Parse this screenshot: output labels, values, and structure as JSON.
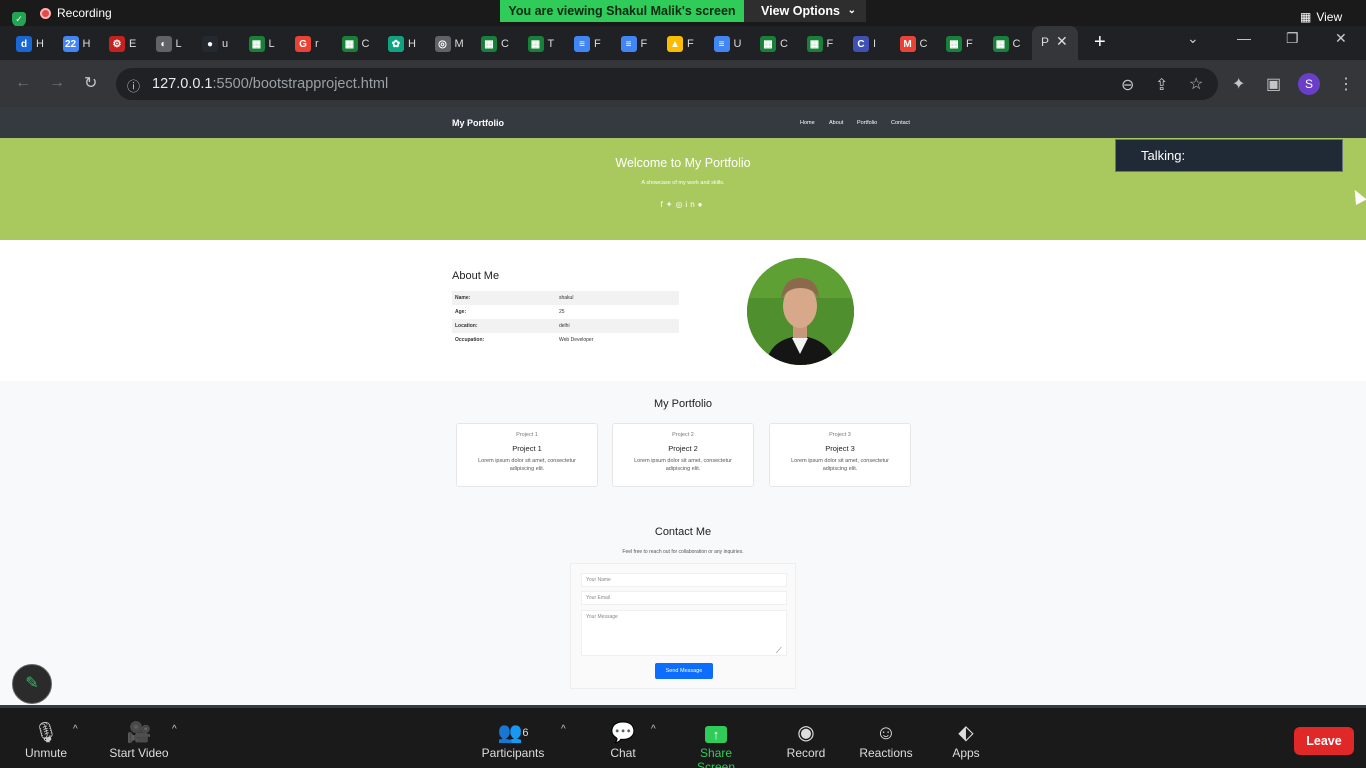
{
  "zoom_top": {
    "recording_label": "Recording",
    "viewing_banner": "You are viewing Shakul Malik's screen",
    "view_options_label": "View Options",
    "view_label": "View"
  },
  "browser": {
    "tabs": [
      {
        "icon": "dictionary-icon",
        "label": "H",
        "color": "#1967d2"
      },
      {
        "icon": "calendar-icon",
        "label": "H",
        "color": "#4285f4"
      },
      {
        "icon": "gear-red-icon",
        "label": "E",
        "color": "#c5221f"
      },
      {
        "icon": "globe-icon",
        "label": "L",
        "color": "#5f6368"
      },
      {
        "icon": "github-icon",
        "label": "u",
        "color": "#24292f"
      },
      {
        "icon": "sheets-icon",
        "label": "L",
        "color": "#188038"
      },
      {
        "icon": "google-icon",
        "label": "r",
        "color": "#ea4335"
      },
      {
        "icon": "sheets-icon",
        "label": "C",
        "color": "#188038"
      },
      {
        "icon": "openai-icon",
        "label": "H",
        "color": "#10a37f"
      },
      {
        "icon": "chrome-icon",
        "label": "M",
        "color": "#5f6368"
      },
      {
        "icon": "sheets-icon",
        "label": "C",
        "color": "#188038"
      },
      {
        "icon": "sheets-icon",
        "label": "T",
        "color": "#188038"
      },
      {
        "icon": "docs-icon",
        "label": "F",
        "color": "#4285f4"
      },
      {
        "icon": "docs-icon",
        "label": "F",
        "color": "#4285f4"
      },
      {
        "icon": "drive-icon",
        "label": "F",
        "color": "#fbbc04"
      },
      {
        "icon": "docs-icon",
        "label": "U",
        "color": "#4285f4"
      },
      {
        "icon": "sheets-icon",
        "label": "C",
        "color": "#188038"
      },
      {
        "icon": "sheets-icon",
        "label": "F",
        "color": "#188038"
      },
      {
        "icon": "code-icon",
        "label": "I",
        "color": "#3f51b5"
      },
      {
        "icon": "gmail-icon",
        "label": "C",
        "color": "#ea4335"
      },
      {
        "icon": "sheets-icon",
        "label": "F",
        "color": "#188038"
      },
      {
        "icon": "sheets-icon",
        "label": "C",
        "color": "#188038"
      }
    ],
    "active_tab_label": "P",
    "url_host": "127.0.0.1",
    "url_rest": ":5500/bootstrapproject.html",
    "profile_initial": "S"
  },
  "site": {
    "brand": "My Portfolio",
    "nav": [
      "Home",
      "About",
      "Portfolio",
      "Contact"
    ],
    "hero_title": "Welcome to My Portfolio",
    "hero_subtitle": "A showcase of my work and skills.",
    "about_title": "About Me",
    "about_rows": [
      {
        "key": "Name:",
        "value": "shakul"
      },
      {
        "key": "Age:",
        "value": "25"
      },
      {
        "key": "Location:",
        "value": "delhi"
      },
      {
        "key": "Occupation:",
        "value": "Web Developer"
      }
    ],
    "portfolio_title": "My Portfolio",
    "projects": [
      {
        "img_alt": "Project 1",
        "title": "Project 1",
        "desc": "Lorem ipsum dolor sit amet, consectetur adipiscing elit."
      },
      {
        "img_alt": "Project 2",
        "title": "Project 2",
        "desc": "Lorem ipsum dolor sit amet, consectetur adipiscing elit."
      },
      {
        "img_alt": "Project 3",
        "title": "Project 3",
        "desc": "Lorem ipsum dolor sit amet, consectetur adipiscing elit."
      }
    ],
    "contact_title": "Contact Me",
    "contact_subtitle": "Feel free to reach out for collaboration or any inquiries.",
    "form": {
      "name_placeholder": "Your Name",
      "email_placeholder": "Your Email",
      "message_placeholder": "Your Message",
      "send_label": "Send Message"
    }
  },
  "overlay": {
    "talking_label": "Talking:"
  },
  "zoom_bottom": {
    "unmute": "Unmute",
    "start_video": "Start Video",
    "participants": "Participants",
    "participant_count": "6",
    "chat": "Chat",
    "share_screen": "Share Screen",
    "record": "Record",
    "reactions": "Reactions",
    "apps": "Apps",
    "leave": "Leave"
  },
  "colors": {
    "hero_bg": "#a9c95f",
    "navbar_bg": "#343a40",
    "share_green": "#2fcc59",
    "leave_red": "#e02828",
    "send_blue": "#0d6efd"
  }
}
